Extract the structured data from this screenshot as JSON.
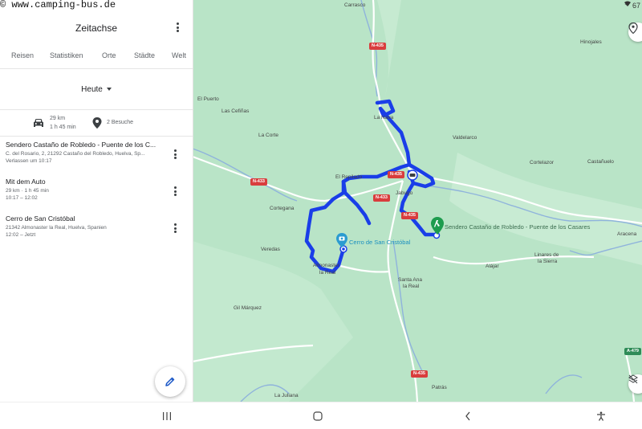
{
  "watermark": "© www.camping-bus.de",
  "panel": {
    "title": "Zeitachse",
    "tabs": [
      "Reisen",
      "Statistiken",
      "Orte",
      "Städte",
      "Welt"
    ],
    "day": "Heute",
    "summary": {
      "distance": "29 km",
      "duration": "1 h 45 min",
      "visits": "2 Besuche"
    },
    "entries": [
      {
        "title": "Sendero Castaño de Robledo - Puente de los C...",
        "line1": "C. del Rosario, 2, 21292 Castaño del Robledo, Huelva, Sp...",
        "line2": "Verlassen um 10:17"
      },
      {
        "title": "Mit dem Auto",
        "line1": "29 km · 1 h 45 min",
        "line2": "10:17 – 12:02"
      },
      {
        "title": "Cerro de San Cristóbal",
        "line1": "21342 Almonaster la Real, Huelva, Spanien",
        "line2": "12:02 – Jetzt"
      }
    ]
  },
  "map": {
    "status_number": "67",
    "towns": {
      "carrasco": "Carrasco",
      "hinojales": "Hinojales",
      "el_puerto": "El Puerto",
      "las_cefinas": "Las Cefiñas",
      "la_nava": "La Nava",
      "la_corte": "La Corte",
      "valdelarco": "Valdelarco",
      "cortelazor": "Cortelazor",
      "castanuelo": "Castañuelo",
      "el_repilado": "El Repilado",
      "jabugo": "Jabugo",
      "cortegana": "Cortegana",
      "aracena": "Aracena",
      "veredas": "Veredas",
      "linares": "Linares de",
      "linares2": "la Sierra",
      "almonaster": "Almonaster",
      "almonaster2": "la Real",
      "alajar": "Alájar",
      "santa_ana": "Santa Ana",
      "santa_ana2": "la Real",
      "gil_marquez": "Gil Márquez",
      "la_juliana": "La Juliana",
      "patras": "Patrás"
    },
    "shields": {
      "n435_top": "N-435",
      "n435_mid": "N-435",
      "n435_jabugo": "N-435",
      "n435_bottom": "N-435",
      "n433_left": "N-433",
      "n433_mid": "N-433",
      "a479": "A-479"
    },
    "poi_start": "Sendero Castaño de Robledo - Puente de los Casares",
    "poi_end": "Cerro de San Cristóbal"
  },
  "colors": {
    "route": "#1a3ee8",
    "map_bg": "#b9e4c7",
    "river": "#8fb3dc",
    "road": "#ffffff"
  }
}
